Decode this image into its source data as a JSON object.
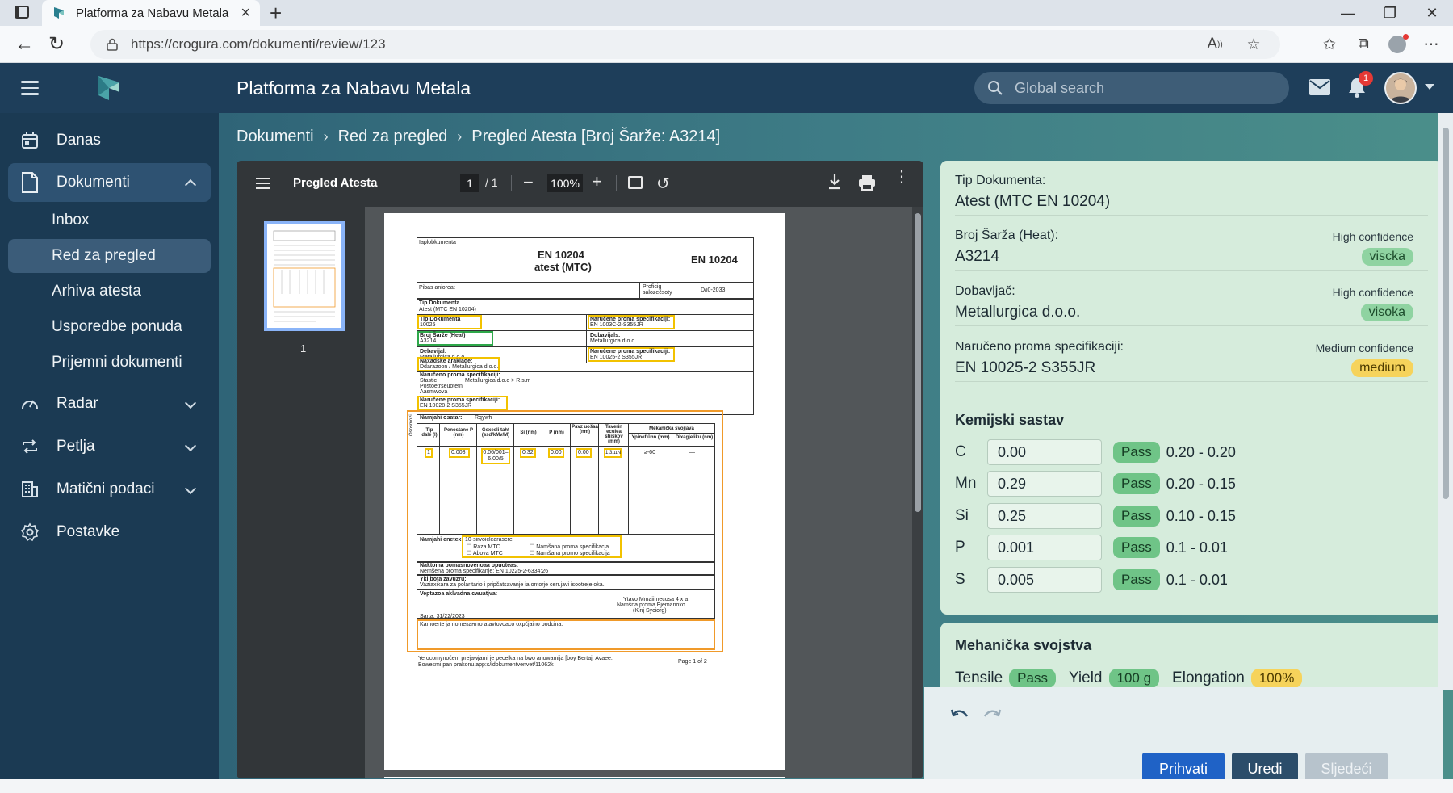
{
  "browser": {
    "tab_title": "Platforma za Nabavu Metala",
    "url": "https://crogura.com/dokumenti/review/123"
  },
  "header": {
    "title": "Platforma za Nabavu Metala",
    "search_placeholder": "Global search",
    "notification_count": "1"
  },
  "sidebar": {
    "items": [
      {
        "label": "Danas",
        "icon": "calendar-icon"
      },
      {
        "label": "Dokumenti",
        "icon": "document-icon"
      },
      {
        "label": "Radar",
        "icon": "gauge-icon"
      },
      {
        "label": "Petlja",
        "icon": "loop-icon"
      },
      {
        "label": "Matični podaci",
        "icon": "building-icon"
      },
      {
        "label": "Postavke",
        "icon": "gear-icon"
      }
    ],
    "sub_items": [
      "Inbox",
      "Red za pregled",
      "Arhiva atesta",
      "Usporedbe ponuda",
      "Prijemni dokumenti"
    ]
  },
  "breadcrumb": [
    "Dokumenti",
    "Red za pregled",
    "Pregled Atesta [Broj Šarže: A3214]"
  ],
  "pdf": {
    "title": "Pregled Atesta",
    "page": "1",
    "page_total": "/ 1",
    "zoom": "100%",
    "thumb_number": "1",
    "doc": {
      "header_small": "Iaplobkumenta",
      "std_title_1": "EN 10204",
      "std_title_2": "atest (MTC)",
      "std_right": "EN 10204",
      "row_pibas": "Pibas anioreat",
      "row_proficig": "Proficig salozečsoty",
      "row_date": "D/i0-2033",
      "tip_dok_label": "Tip Dokumenta",
      "tip_dok_val": "Atest (MTC EN 10204)",
      "tip_dok2_label": "Tip Dokumenta",
      "tip_dok2_val": "10025",
      "naruceno_label": "Naručene proma specifikaciji:",
      "naruceno_val": "EN 1003C-2-S355JR",
      "broj_label": "Broj Šarže (Heat)",
      "broj_val": "A3214",
      "dobav_label": "Dobavijals:",
      "dobav_val": "Metallurgica d.o.o.",
      "debav_label": "Debavijal:",
      "debav_val": "Metallurgica d.o.o.",
      "nar2_label": "Naručene proma specifikaciji:",
      "nar2_val": "EN 10025-2 S355JR",
      "nar3_label": "Naručene proma specifikaciji:",
      "nar3_val": "EN 10028-2 S355JR",
      "nazad_label": "Naxadske arakiade:",
      "nazad_val": "Ddarazoon / Metallurgica d.o.o.",
      "nar4_label": "Naručeno proma specifikaciji:",
      "nar4_l1": "Stastic",
      "nar4_l1b": "Metallurgica d.o.o > R.s.m",
      "nar4_l2": "Postoetrseuotetn",
      "nar4_l3": "Aasmwova",
      "namj_label": "Namjahi osatar:",
      "namj_val": "Rqywh",
      "side_label": "Ososmozi",
      "col_headers": [
        "Tip dale (l)",
        "Penostane P (nm)",
        "Gexeeli taht (ssd/kMv/M)",
        "Si (nm)",
        "P (nm)",
        "Pavz uošaa (nm)",
        "Taverin ecuiea stiiŝkov (mm)",
        "Mekanička svojjava"
      ],
      "col_sub": [
        "Ypinef ünn (mm)",
        "Dixagjeliku (nm)"
      ],
      "cells": [
        "1",
        "0.008",
        "0.06/001–6.00/5",
        "0.32",
        "0.00",
        "0.00",
        "1.3ɪɪɪN",
        "≥-60",
        "—"
      ],
      "namj2_label": "Namjahi enetex:",
      "namj2_val": "10-sirvoiclearascre",
      "cb1": "Raza MTC",
      "cb2": "Abova MTC",
      "cb3": "Namšana proma specifikacja",
      "cb4": "Namšana promo specifikacija",
      "nakt_label": "Naktoma pomasnovenoaa opuoteas:",
      "nakt_val": "Nemšena proma specifikanje: EN 10225-2-6334:26",
      "yks_label": "Yklibota zavuzru:",
      "yks_val": "Vaziaxikara za polaritario i pripčatsavanje ia ontorje cerr.javi isootreje oka.",
      "vept_label": "Veptazoa aklvadna cwuatjva:",
      "vept_r1": "Ytavo Mmaiimecosa 4 x a",
      "vept_r2": "Namšna proma Бjemanoxo",
      "vept_r3": "(Kinj Syciorg)",
      "sarta": "Sarta: 31/22/2023",
      "karu": "Kamoerte ja nomeкантro atavtovoaco oxpčjaino podcina.",
      "foot1": "Ye ocomynoćem prejawjami je pecelka na bwo anowamija [boy Bertaj. Avaee.",
      "foot2": "Bowesmi pan prakonu.app:s/idokumentvenvet/11062k",
      "page_of": "Page 1 of 2"
    }
  },
  "panel": {
    "fields": [
      {
        "label": "Tip Dokumenta:",
        "value": "Atest (MTC EN 10204)",
        "confidence": "",
        "badge": ""
      },
      {
        "label": "Broj Šarža (Heat):",
        "value": "A3214",
        "confidence": "High confidence",
        "badge": "viscka"
      },
      {
        "label": "Dobavljač:",
        "value": "Metallurgica d.o.o.",
        "confidence": "High confidence",
        "badge": "visoka"
      },
      {
        "label": "Naručeno proma specifikaciji:",
        "value": "EN 10025-2 S355JR",
        "confidence": "Medium confidence",
        "badge": "medium"
      }
    ],
    "chem_title": "Kemijski sastav",
    "chem": [
      {
        "el": "C",
        "value": "0.00",
        "status": "Pass",
        "range": "0.20 - 0.20"
      },
      {
        "el": "Mn",
        "value": "0.29",
        "status": "Pass",
        "range": "0.20 - 0.15"
      },
      {
        "el": "Si",
        "value": "0.25",
        "status": "Pass",
        "range": "0.10 - 0.15"
      },
      {
        "el": "P",
        "value": "0.001",
        "status": "Pass",
        "range": "0.1 - 0.01"
      },
      {
        "el": "S",
        "value": "0.005",
        "status": "Pass",
        "range": "0.1 - 0.01"
      }
    ],
    "mech_title": "Mehanička svojstva",
    "mech": {
      "tensile_label": "Tensile",
      "tensile_val": "Pass",
      "yield_label": "Yield",
      "yield_val": "100 g",
      "elong_label": "Elongation",
      "elong_val": "100%"
    }
  },
  "actions": {
    "accept": "Prihvati",
    "edit": "Uredi",
    "next": "Sljedeći"
  },
  "colors": {
    "header": "#1e3e5a",
    "sidebar": "#1b3a53",
    "primary_button": "#1f62c6",
    "pass": "#6fc487",
    "medium": "#f6d35b"
  }
}
